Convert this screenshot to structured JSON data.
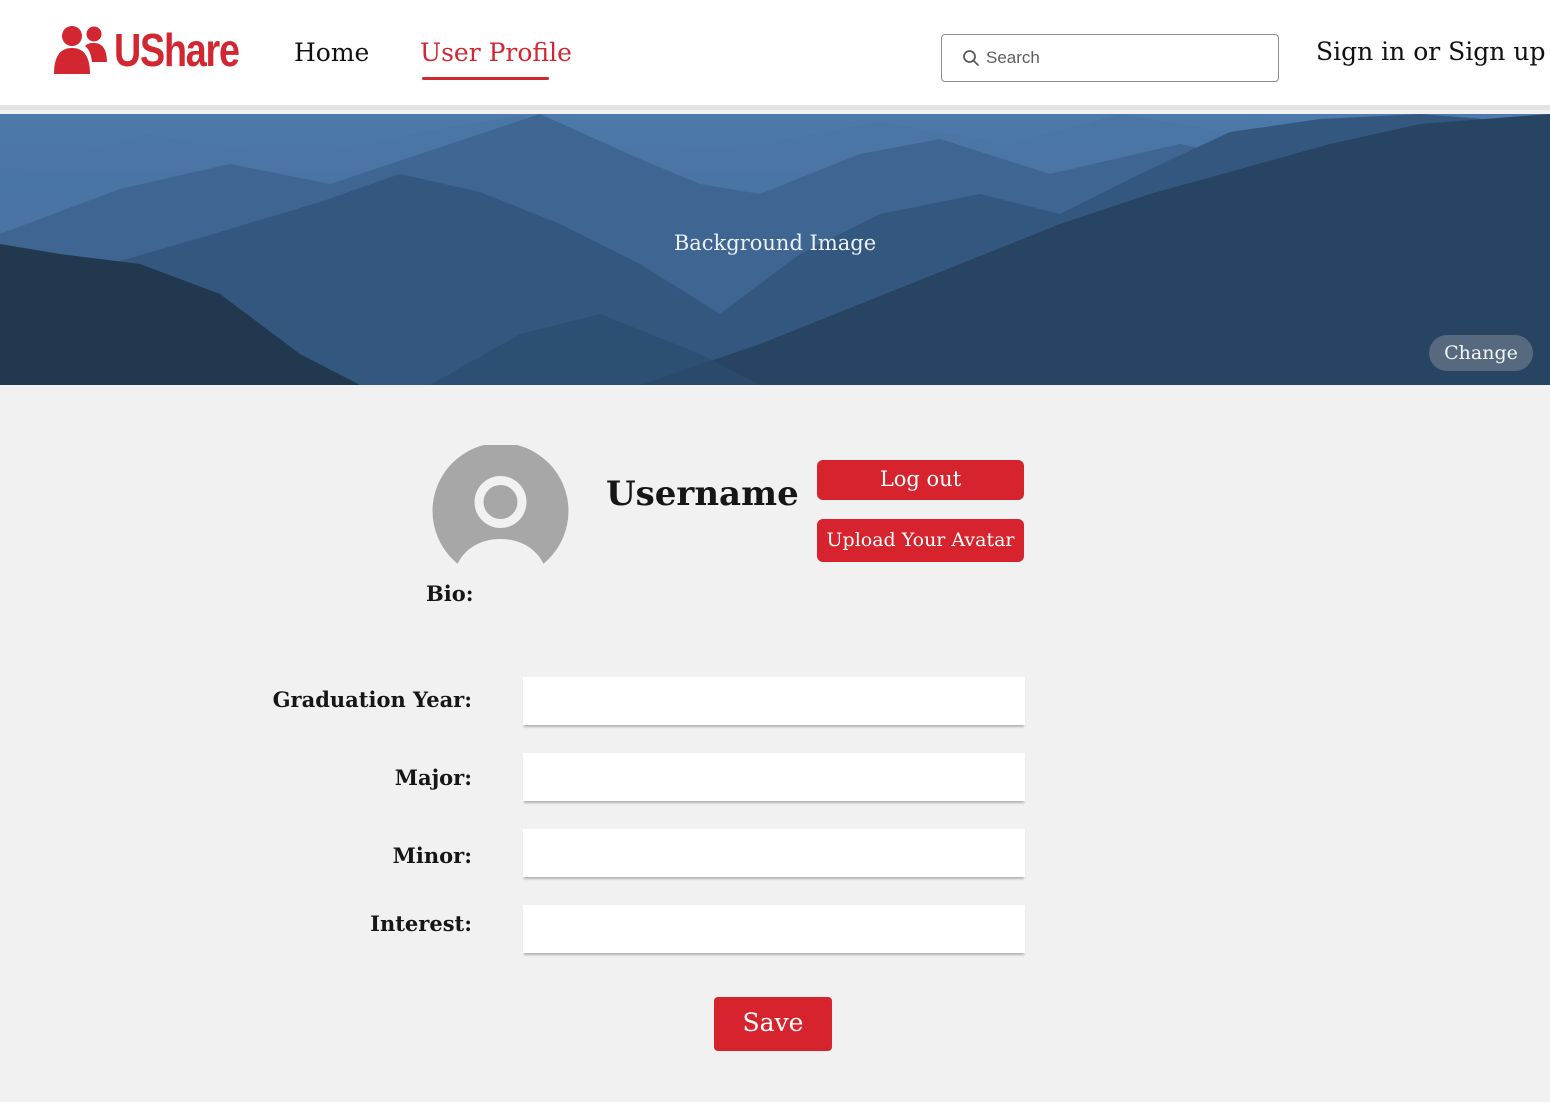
{
  "app": {
    "name": "UShare",
    "brand_color": "#d22630"
  },
  "header": {
    "logo_icon": "users-icon",
    "nav": [
      {
        "label": "Home",
        "active": false
      },
      {
        "label": "User Profile",
        "active": true
      }
    ],
    "search": {
      "placeholder": "Search",
      "value": "",
      "icon": "search-icon"
    },
    "auth_link": "Sign in or Sign up"
  },
  "banner": {
    "label": "Background Image",
    "change_button": "Change"
  },
  "profile": {
    "avatar_icon": "user-avatar-placeholder",
    "username": "Username",
    "logout_button": "Log out",
    "upload_button": "Upload Your Avatar",
    "bio_label": "Bio:"
  },
  "form": {
    "fields": [
      {
        "label": "Graduation Year:",
        "value": ""
      },
      {
        "label": "Major:",
        "value": ""
      },
      {
        "label": "Minor:",
        "value": ""
      },
      {
        "label": "Interest:",
        "value": ""
      }
    ],
    "save_button": "Save"
  }
}
